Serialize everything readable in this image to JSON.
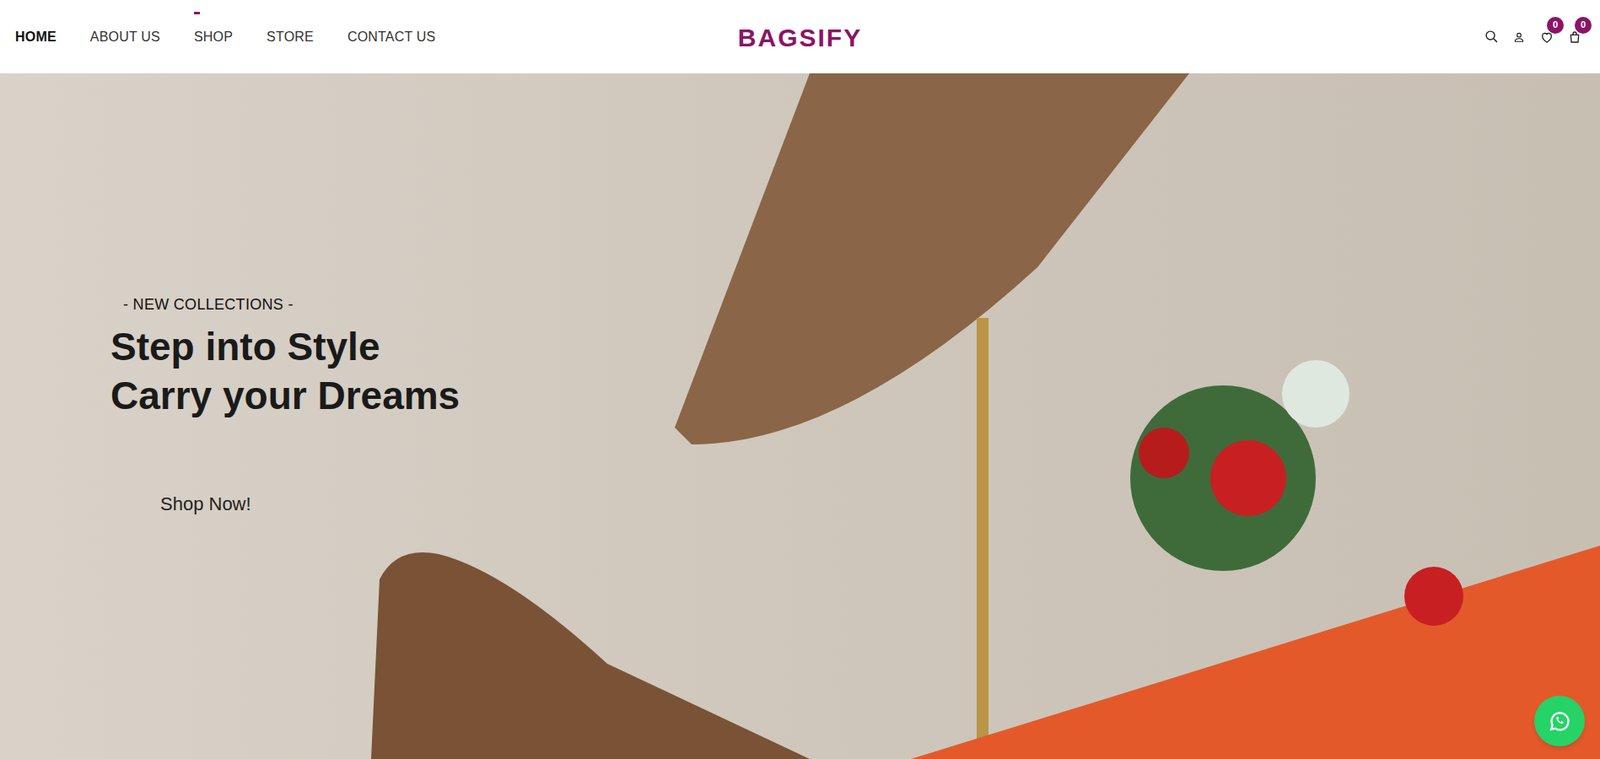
{
  "nav": {
    "items": [
      {
        "label": "HOME",
        "selected": true
      },
      {
        "label": "ABOUT US",
        "selected": false
      },
      {
        "label": "SHOP",
        "selected": false
      },
      {
        "label": "STORE",
        "selected": false
      },
      {
        "label": "CONTACT US",
        "selected": false
      }
    ]
  },
  "logo": "BAGSIFY",
  "header_icons": {
    "wishlist_count": "0",
    "cart_count": "0"
  },
  "hero": {
    "eyebrow": "- NEW COLLECTIONS -",
    "headline": [
      "Step into Style",
      "Carry your Dreams"
    ],
    "button": "Shop Now!"
  }
}
